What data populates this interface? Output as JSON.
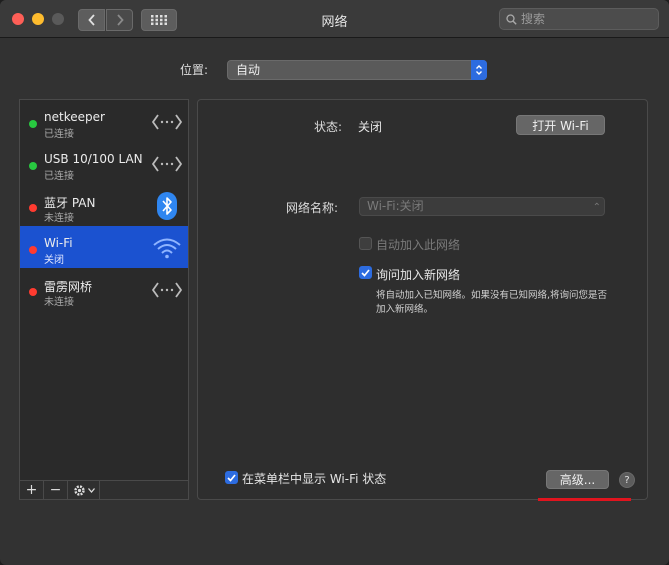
{
  "window": {
    "title": "网络",
    "search_placeholder": "搜索"
  },
  "location": {
    "label": "位置:",
    "value": "自动"
  },
  "services": [
    {
      "name": "netkeeper",
      "status": "已连接",
      "status_color": "green",
      "icon": "ethernet-arrows-icon"
    },
    {
      "name": "USB 10/100 LAN",
      "status": "已连接",
      "status_color": "green",
      "icon": "ethernet-arrows-icon"
    },
    {
      "name": "蓝牙 PAN",
      "status": "未连接",
      "status_color": "red",
      "icon": "bluetooth-icon"
    },
    {
      "name": "Wi-Fi",
      "status": "关闭",
      "status_color": "red",
      "icon": "wifi-icon",
      "selected": true
    },
    {
      "name": "雷雳网桥",
      "status": "未连接",
      "status_color": "red",
      "icon": "ethernet-arrows-icon"
    }
  ],
  "sidebar_buttons": {
    "add": "+",
    "remove": "−"
  },
  "detail": {
    "status_label": "状态:",
    "status_value": "关闭",
    "toggle_wifi_button": "打开 Wi-Fi",
    "network_name_label": "网络名称:",
    "network_name_value": "Wi-Fi:关闭",
    "auto_join_label": "自动加入此网络",
    "ask_join_label": "询问加入新网络",
    "ask_join_hint": "将自动加入已知网络。如果没有已知网络,将询问您是否加入新网络。",
    "show_in_menubar_label": "在菜单栏中显示 Wi-Fi 状态",
    "advanced_button": "高级...",
    "help_button": "?"
  },
  "colors": {
    "accent": "#2d6ce0",
    "selection": "#1b52d0",
    "connected": "#28c840",
    "disconnected": "#ff3b30",
    "annotation": "#e0141e"
  }
}
